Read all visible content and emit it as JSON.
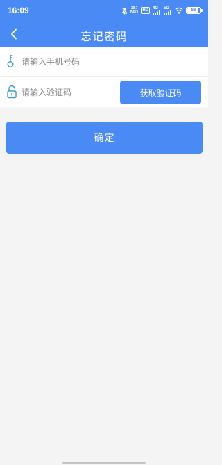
{
  "status_bar": {
    "time": "16:09",
    "net_speed_value": "19.7",
    "net_speed_unit": "KB/s",
    "hd_label": "HD",
    "net1_label": "4G",
    "net2_label": "5G",
    "battery_level": "86",
    "icons": [
      "mute-icon",
      "signal-icon",
      "wifi-icon",
      "battery-icon"
    ]
  },
  "header": {
    "title": "忘记密码",
    "back_icon": "chevron-left-icon"
  },
  "form": {
    "phone": {
      "icon": "key-icon",
      "placeholder": "请输入手机号码",
      "value": ""
    },
    "code": {
      "icon": "unlock-icon",
      "placeholder": "请输入验证码",
      "value": "",
      "button_label": "获取验证码"
    }
  },
  "confirm_label": "确定",
  "colors": {
    "accent": "#4a8af4",
    "background": "#f4f4f4",
    "icon": "#3a9ad9"
  }
}
